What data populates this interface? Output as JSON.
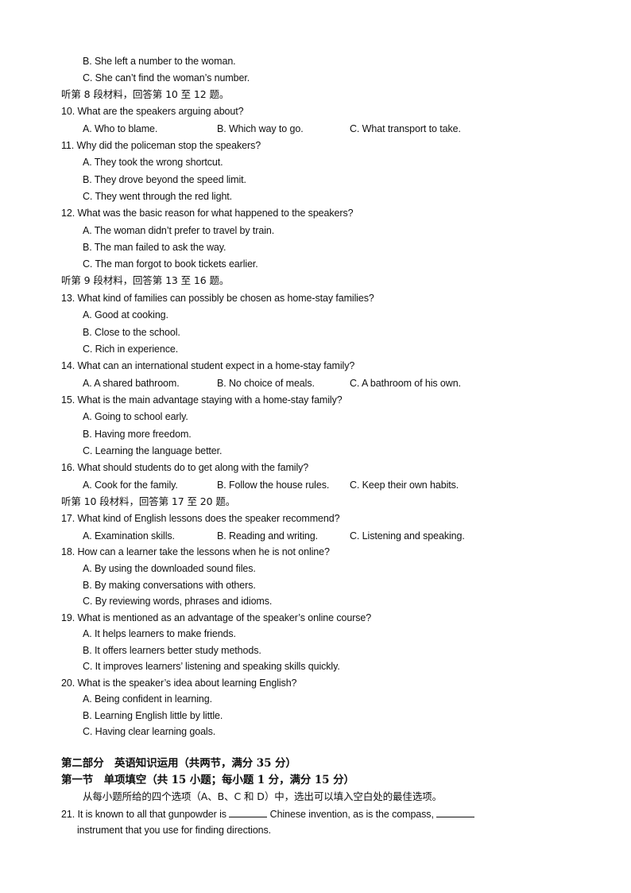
{
  "lines": {
    "q9b": "B. She left a number  to the woman.",
    "q9c": "C. She can’t find the woman’s number.",
    "sec8": "听第 8 段材料，回答第 10 至 12 题。",
    "q10": "10. What are the speakers arguing about?",
    "q10a": "A. Who to blame.",
    "q10b": "B. Which way to go.",
    "q10c": "C. What transport to take.",
    "q11": "11. Why did the policeman  stop the speakers?",
    "q11a": "A. They took the wrong shortcut.",
    "q11b": "B. They drove beyond the speed limit.",
    "q11c": "C. They went through the red light.",
    "q12": "12. What was the basic reason for what happened to the speakers?",
    "q12a": "A. The woman didn’t prefer to travel by train.",
    "q12b": "B. The man failed to ask the way.",
    "q12c": "C. The man forgot to book tickets earlier.",
    "sec9": "听第 9 段材料，回答第 13 至 16 题。",
    "q13": "13. What kind  of families  can possibly be chosen  as home-stay families?",
    "q13a": "A. Good at cooking.",
    "q13b": "B. Close to the school.",
    "q13c": "C. Rich in experience.",
    "q14": "14. What can an international  student expect in a home-stay family?",
    "q14a": "A. A shared bathroom.",
    "q14b": "B. No choice of meals.",
    "q14c": "C. A bathroom of his own.",
    "q15": "15. What is the main advantage staying with a home-stay family?",
    "q15a": "A. Going to school early.",
    "q15b": "B. Having more freedom.",
    "q15c": "C. Learning the language better.",
    "q16": "16. What should students do to get along with the family?",
    "q16a": "A. Cook for the family.",
    "q16b": "B. Follow the house rules.",
    "q16c": "C. Keep their own habits.",
    "sec10": "听第 10 段材料，回答第 17 至 20 题。",
    "q17": "17. What kind  of English lessons does the speaker recommend?",
    "q17a": "A. Examination skills.",
    "q17b": "B. Reading and writing.",
    "q17c": "C. Listening and speaking.",
    "q18": "18. How can a learner take the lessons when he is not online?",
    "q18a": "A. By using the downloaded  sound  files.",
    "q18b": "B. By making conversations with others.",
    "q18c": "C. By reviewing words, phrases and idioms.",
    "q19": "19. What is mentioned  as an advantage of the speaker’s online course?",
    "q19a": "A. It helps learners to make friends.",
    "q19b": "B. It offers learners better study methods.",
    "q19c": "C. It improves learners’ listening and speaking skills quickly.",
    "q20": "20. What is the speaker’s idea about learning English?",
    "q20a": "A. Being confident  in learning.",
    "q20b": "B. Learning English little by little.",
    "q20c": "C. Having clear learning goals.",
    "part2": "第二部分　英语知识运用（共两节，满分 35 分）",
    "sec1": "第一节　单项填空（共 15 小题；每小题 1 分，满分 15 分）",
    "instruction": "从每小题所给的四个选项（A、B、C 和 D）中，选出可以填入空白处的最佳选项。",
    "q21_part1": "21. It is known to all that gunpowder is ",
    "q21_part2": " Chinese invention, as is the compass, ",
    "q21_cont": "instrument that you use for finding  directions."
  }
}
